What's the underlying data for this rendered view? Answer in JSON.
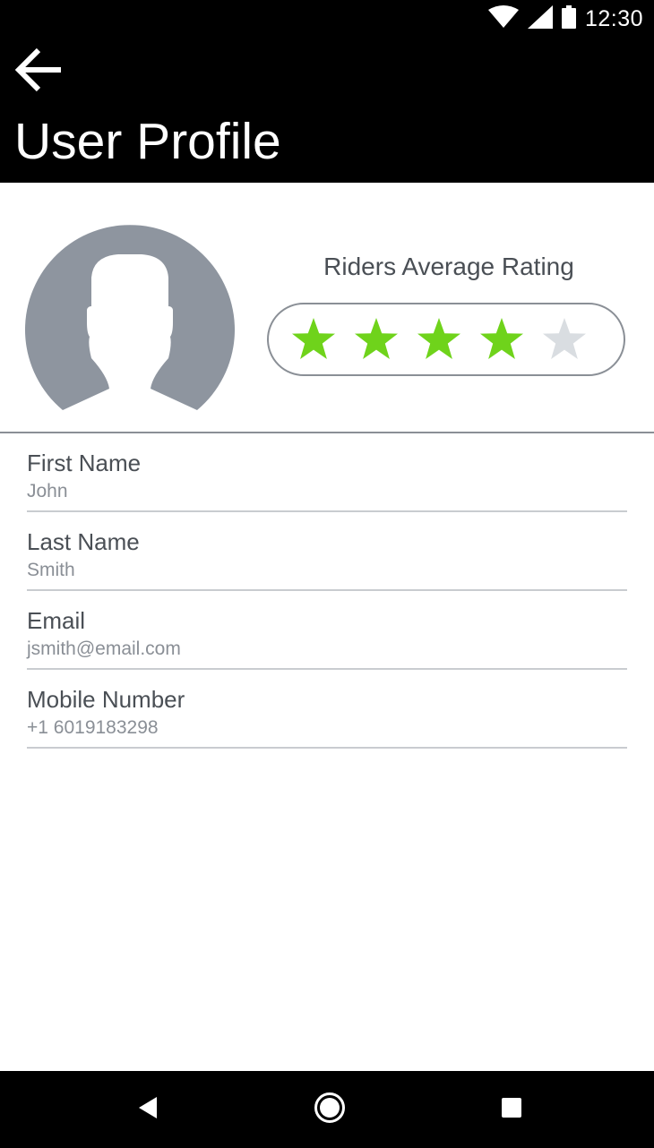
{
  "status_bar": {
    "time": "12:30",
    "icons": [
      "wifi-icon",
      "cellular-signal-icon",
      "battery-icon"
    ]
  },
  "app_bar": {
    "back_icon": "arrow-left-icon",
    "title": "User Profile"
  },
  "profile": {
    "avatar_icon": "user-silhouette-icon",
    "rating_label": "Riders Average Rating",
    "rating": 4,
    "rating_max": 5,
    "star_filled_color": "#6fd31b",
    "star_empty_color": "#d9dde1"
  },
  "fields": [
    {
      "label": "First Name",
      "value": "John"
    },
    {
      "label": "Last Name",
      "value": "Smith"
    },
    {
      "label": "Email",
      "value": "jsmith@email.com"
    },
    {
      "label": "Mobile Number",
      "value": "+1 6019183298"
    }
  ],
  "nav_bar": {
    "buttons": [
      "back-triangle-icon",
      "home-circle-icon",
      "recents-square-icon"
    ]
  }
}
